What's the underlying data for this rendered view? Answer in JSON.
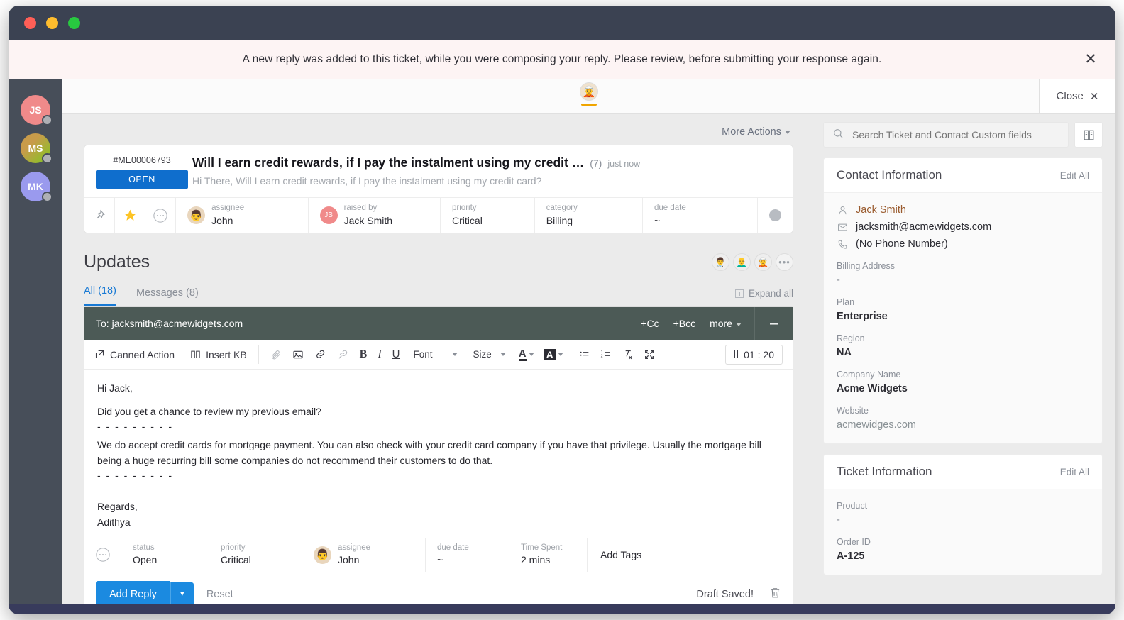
{
  "window": {
    "traffic_lights": [
      "close",
      "minimize",
      "zoom"
    ]
  },
  "alert": {
    "message": "A new reply was added to this ticket, while you were composing your reply. Please review, before submitting your response again.",
    "close_icon": "close-icon",
    "bg": "#fdf4f4",
    "border": "#e4a9a9"
  },
  "rail": {
    "items": [
      {
        "initials": "JS",
        "color": "#f08a8a",
        "presence": "away"
      },
      {
        "initials": "MS",
        "color": "#b9a23c",
        "presence": "away"
      },
      {
        "initials": "MK",
        "color": "#9a9aee",
        "presence": "away"
      }
    ]
  },
  "app_top": {
    "avatar_emoji": "🧝",
    "close_label": "Close",
    "close_icon": "close-icon"
  },
  "main": {
    "more_actions": "More Actions",
    "ticket": {
      "id": "#ME00006793",
      "status": "OPEN",
      "status_color": "#0f6ecd",
      "subject": "Will I earn credit rewards, if I pay the instalment using my credit …",
      "reply_count": "(7)",
      "timestamp": "just now",
      "preview": "Hi There, Will I earn credit rewards, if I pay the instalment using my credit card?",
      "props": [
        {
          "label": "assignee",
          "value": "John",
          "avatar": "👨",
          "avatar_color": "#e9d6bd"
        },
        {
          "label": "raised by",
          "value": "Jack Smith",
          "avatar": "JS",
          "avatar_color": "#f08a8a"
        },
        {
          "label": "priority",
          "value": "Critical"
        },
        {
          "label": "category",
          "value": "Billing"
        },
        {
          "label": "due date",
          "value": "~"
        }
      ],
      "pin_icon": "pin-icon",
      "star_icon": "star-icon",
      "ellipsis_icon": "ellipsis-icon"
    },
    "updates": {
      "title": "Updates",
      "avatars": [
        "👨‍⚕️",
        "👨‍🦲",
        "🧝"
      ],
      "more_icon": "ellipsis-icon",
      "tabs": [
        {
          "label": "All (18)",
          "active": true
        },
        {
          "label": "Messages (8)",
          "active": false
        }
      ],
      "expand_all": "Expand all",
      "expand_icon": "plus-box-icon"
    },
    "composer": {
      "to_prefix": "To:",
      "to_address": "jacksmith@acmewidgets.com",
      "cc_label": "+Cc",
      "bcc_label": "+Bcc",
      "more_label": "more",
      "minimize_icon": "minimize-icon",
      "toolbar": {
        "canned_action": "Canned Action",
        "insert_kb": "Insert KB",
        "font_label": "Font",
        "size_label": "Size",
        "icons": [
          "attachment-icon",
          "image-icon",
          "link-icon",
          "unlink-icon",
          "bold-icon",
          "italic-icon",
          "underline-icon",
          "text-color-icon",
          "highlight-color-icon",
          "bullet-list-icon",
          "numbered-list-icon",
          "clear-format-icon",
          "fullscreen-icon"
        ],
        "timer": "01 : 20",
        "timer_state_icon": "pause-icon"
      },
      "body": {
        "greeting": "Hi Jack,",
        "line1": "Did you get a chance to review my previous email?",
        "divider1": "- - - - - - - - -",
        "paragraph": "We do accept credit cards for mortgage payment. You can also check with your credit card company if you have that privilege. Usually the mortgage bill being a huge recurring bill some companies do not recommend their customers to do that.",
        "divider2": "- - - - - - - - -",
        "signoff": "Regards,",
        "signature": "Adithya"
      },
      "props": [
        {
          "label": "status",
          "value": "Open"
        },
        {
          "label": "priority",
          "value": "Critical"
        },
        {
          "label": "assignee",
          "value": "John",
          "avatar": "👨",
          "avatar_color": "#e9d6bd"
        },
        {
          "label": "due date",
          "value": "~"
        },
        {
          "label": "Time Spent",
          "value": "2 mins"
        }
      ],
      "add_tags": "Add Tags",
      "ellipsis_icon": "ellipsis-icon",
      "submit_label": "Add Reply",
      "submit_color": "#1b8ae0",
      "split_icon": "chevron-down-icon",
      "reset_label": "Reset",
      "draft_status": "Draft Saved!",
      "delete_icon": "trash-icon"
    }
  },
  "sidebar": {
    "search": {
      "placeholder": "Search Ticket and Contact Custom fields",
      "value": "",
      "icon": "search-icon",
      "kb_icon": "book-icon"
    },
    "panels": [
      {
        "title": "Contact Information",
        "edit_label": "Edit All",
        "contact": {
          "name": "Jack Smith",
          "name_icon": "user-icon",
          "email": "jacksmith@acmewidgets.com",
          "email_icon": "envelope-icon",
          "phone": "(No Phone Number)",
          "phone_icon": "phone-icon"
        },
        "fields": [
          {
            "label": "Billing Address",
            "value": "-",
            "style": "muted"
          },
          {
            "label": "Plan",
            "value": "Enterprise",
            "style": "bold"
          },
          {
            "label": "Region",
            "value": "NA",
            "style": "bold"
          },
          {
            "label": "Company Name",
            "value": "Acme Widgets",
            "style": "bold"
          },
          {
            "label": "Website",
            "value": "acmewidges.com",
            "style": "link"
          }
        ]
      },
      {
        "title": "Ticket Information",
        "edit_label": "Edit All",
        "fields": [
          {
            "label": "Product",
            "value": "-",
            "style": "muted"
          },
          {
            "label": "Order ID",
            "value": "A-125",
            "style": "bold"
          }
        ]
      }
    ]
  }
}
